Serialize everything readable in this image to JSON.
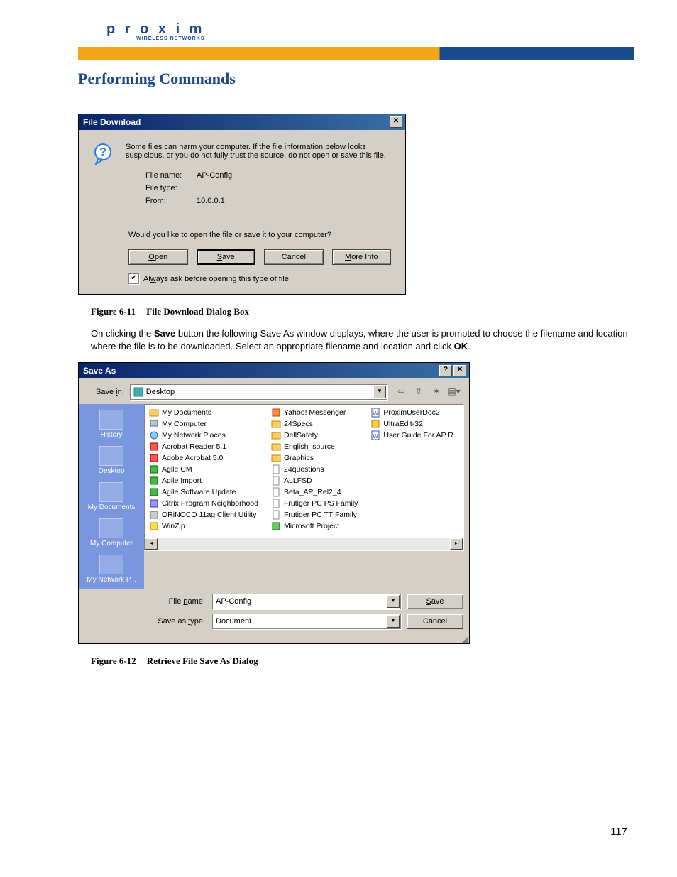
{
  "logo": {
    "brand": "p r o x i m",
    "tagline": "WIRELESS NETWORKS"
  },
  "page_title": "Performing Commands",
  "page_number": "117",
  "dialog1": {
    "title": "File Download",
    "warning": "Some files can harm your computer. If the file information below looks suspicious, or you do not fully trust the source, do not open or save this file.",
    "file_name_label": "File name:",
    "file_name": "AP-Config",
    "file_type_label": "File type:",
    "file_type": "",
    "from_label": "From:",
    "from": "10.0.0.1",
    "prompt": "Would you like to open the file or save it to your computer?",
    "buttons": {
      "open": "Open",
      "save": "Save",
      "cancel": "Cancel",
      "more": "More Info"
    },
    "checkbox_label": "Always ask before opening this type of file",
    "checkbox_checked": "✔"
  },
  "caption1": {
    "label": "Figure 6-11",
    "text": "File Download Dialog Box"
  },
  "body_text": {
    "pre": "On clicking the ",
    "bold1": "Save",
    "mid": " button the following Save As window displays, where the user is prompted to choose the filename and location where the file is to be downloaded. Select an appropriate filename and location and click ",
    "bold2": "OK",
    "post": "."
  },
  "dialog2": {
    "title": "Save As",
    "save_in_label": "Save in:",
    "save_in_value": "Desktop",
    "toolbar_icons": [
      "back-icon",
      "up-icon",
      "new-folder-icon",
      "views-icon"
    ],
    "places": [
      "History",
      "Desktop",
      "My Documents",
      "My Computer",
      "My Network P..."
    ],
    "columns": [
      [
        "My Documents",
        "My Computer",
        "My Network Places",
        "Acrobat Reader 5.1",
        "Adobe Acrobat 5.0",
        "Agile CM",
        "Agile Import",
        "Agile Software Update",
        "Citrix Program Neighborhood",
        "ORiNOCO 11ag Client Utility",
        "WinZip"
      ],
      [
        "Yahoo! Messenger",
        "24Specs",
        "DellSafety",
        "English_source",
        "Graphics",
        "24questions",
        "ALLFSD",
        "Beta_AP_Rel2_4",
        "Frutiger PC PS Family",
        "Frutiger PC TT Family",
        "Microsoft Project"
      ],
      [
        "ProximUserDoc2",
        "UltraEdit-32",
        "User Guide For AP R"
      ]
    ],
    "file_name_label": "File name:",
    "file_name_value": "AP-Config",
    "save_type_label": "Save as type:",
    "save_type_value": "Document",
    "buttons": {
      "save": "Save",
      "cancel": "Cancel"
    }
  },
  "caption2": {
    "label": "Figure 6-12",
    "text": "Retrieve File Save As Dialog"
  }
}
